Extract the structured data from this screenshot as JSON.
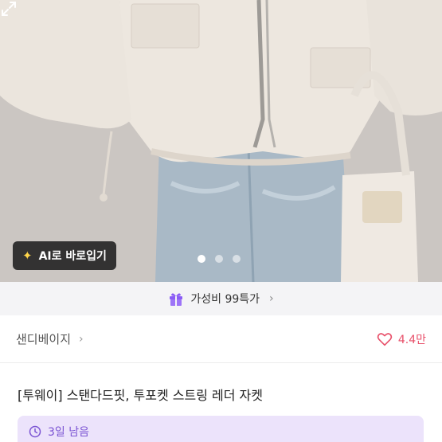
{
  "photo": {
    "ai_button_label": "AI로 바로입기",
    "carousel": {
      "total": 3,
      "active_index": 0
    }
  },
  "promo": {
    "label": "가성비 99특가"
  },
  "seller": {
    "name": "샌디베이지",
    "likes": "4.4만"
  },
  "product": {
    "title": "[투웨이] 스탠다드핏, 투포켓 스트링 레더 자켓"
  },
  "badge": {
    "time_left": "3일 남음"
  },
  "colors": {
    "accent": "#7b54d3",
    "like": "#e8506a",
    "promo_icon": "#8a5cf5"
  }
}
